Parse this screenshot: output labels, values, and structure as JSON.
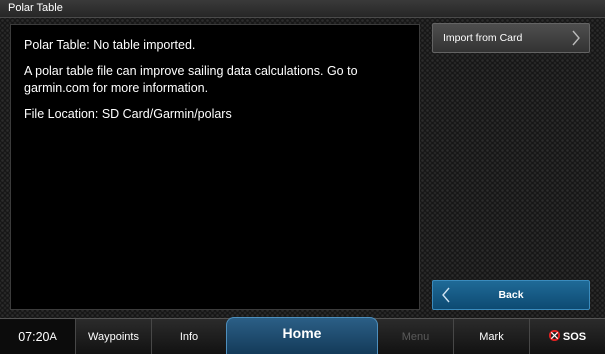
{
  "window": {
    "title": "Polar Table"
  },
  "info": {
    "line1": "Polar Table: No table imported.",
    "line2": "A polar table file can improve sailing data calculations. Go to garmin.com for more information.",
    "line3": "File Location: SD Card/Garmin/polars"
  },
  "buttons": {
    "import": "Import from Card",
    "back": "Back"
  },
  "bottombar": {
    "time": "07:20",
    "time_suffix": "A",
    "waypoints": "Waypoints",
    "info": "Info",
    "home": "Home",
    "menu": "Menu",
    "mark": "Mark",
    "sos": "SOS"
  },
  "colors": {
    "accent_blue": "#1f6a97",
    "sos_red": "#e02020",
    "disabled_text": "#5a5a5a"
  },
  "icons": {
    "import_chevron": "chevron-right-icon",
    "back_chevron": "chevron-left-icon",
    "sos": "lifebuoy-icon"
  }
}
